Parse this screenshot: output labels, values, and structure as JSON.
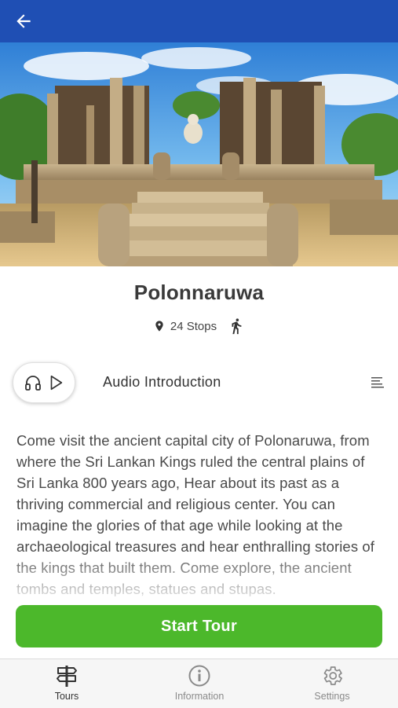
{
  "header": {
    "back_icon": "back-arrow-icon",
    "color": "#1f4fb4"
  },
  "tour": {
    "title": "Polonnaruwa",
    "stops_icon": "map-pin-icon",
    "stops_label": "24 Stops",
    "mode_icon": "walking-icon"
  },
  "audio": {
    "label": "Audio Introduction",
    "icons": [
      "headphones-icon",
      "play-icon"
    ],
    "menu_icon": "list-icon"
  },
  "description": "Come visit the ancient capital city of Polonaruwa, from where the Sri Lankan Kings ruled the central plains of Sri Lanka 800 years ago, Hear about its past as a thriving commercial and religious center. You can imagine the glories of that age while looking at the archaeological treasures and hear enthralling stories of the kings that built them. Come explore, the ancient tombs and temples, statues and stupas.",
  "start_button": {
    "label": "Start Tour",
    "color": "#4cb82b"
  },
  "tabs": [
    {
      "label": "Tours",
      "icon": "signpost-icon",
      "active": true
    },
    {
      "label": "Information",
      "icon": "info-icon",
      "active": false
    },
    {
      "label": "Settings",
      "icon": "gear-icon",
      "active": false
    }
  ]
}
